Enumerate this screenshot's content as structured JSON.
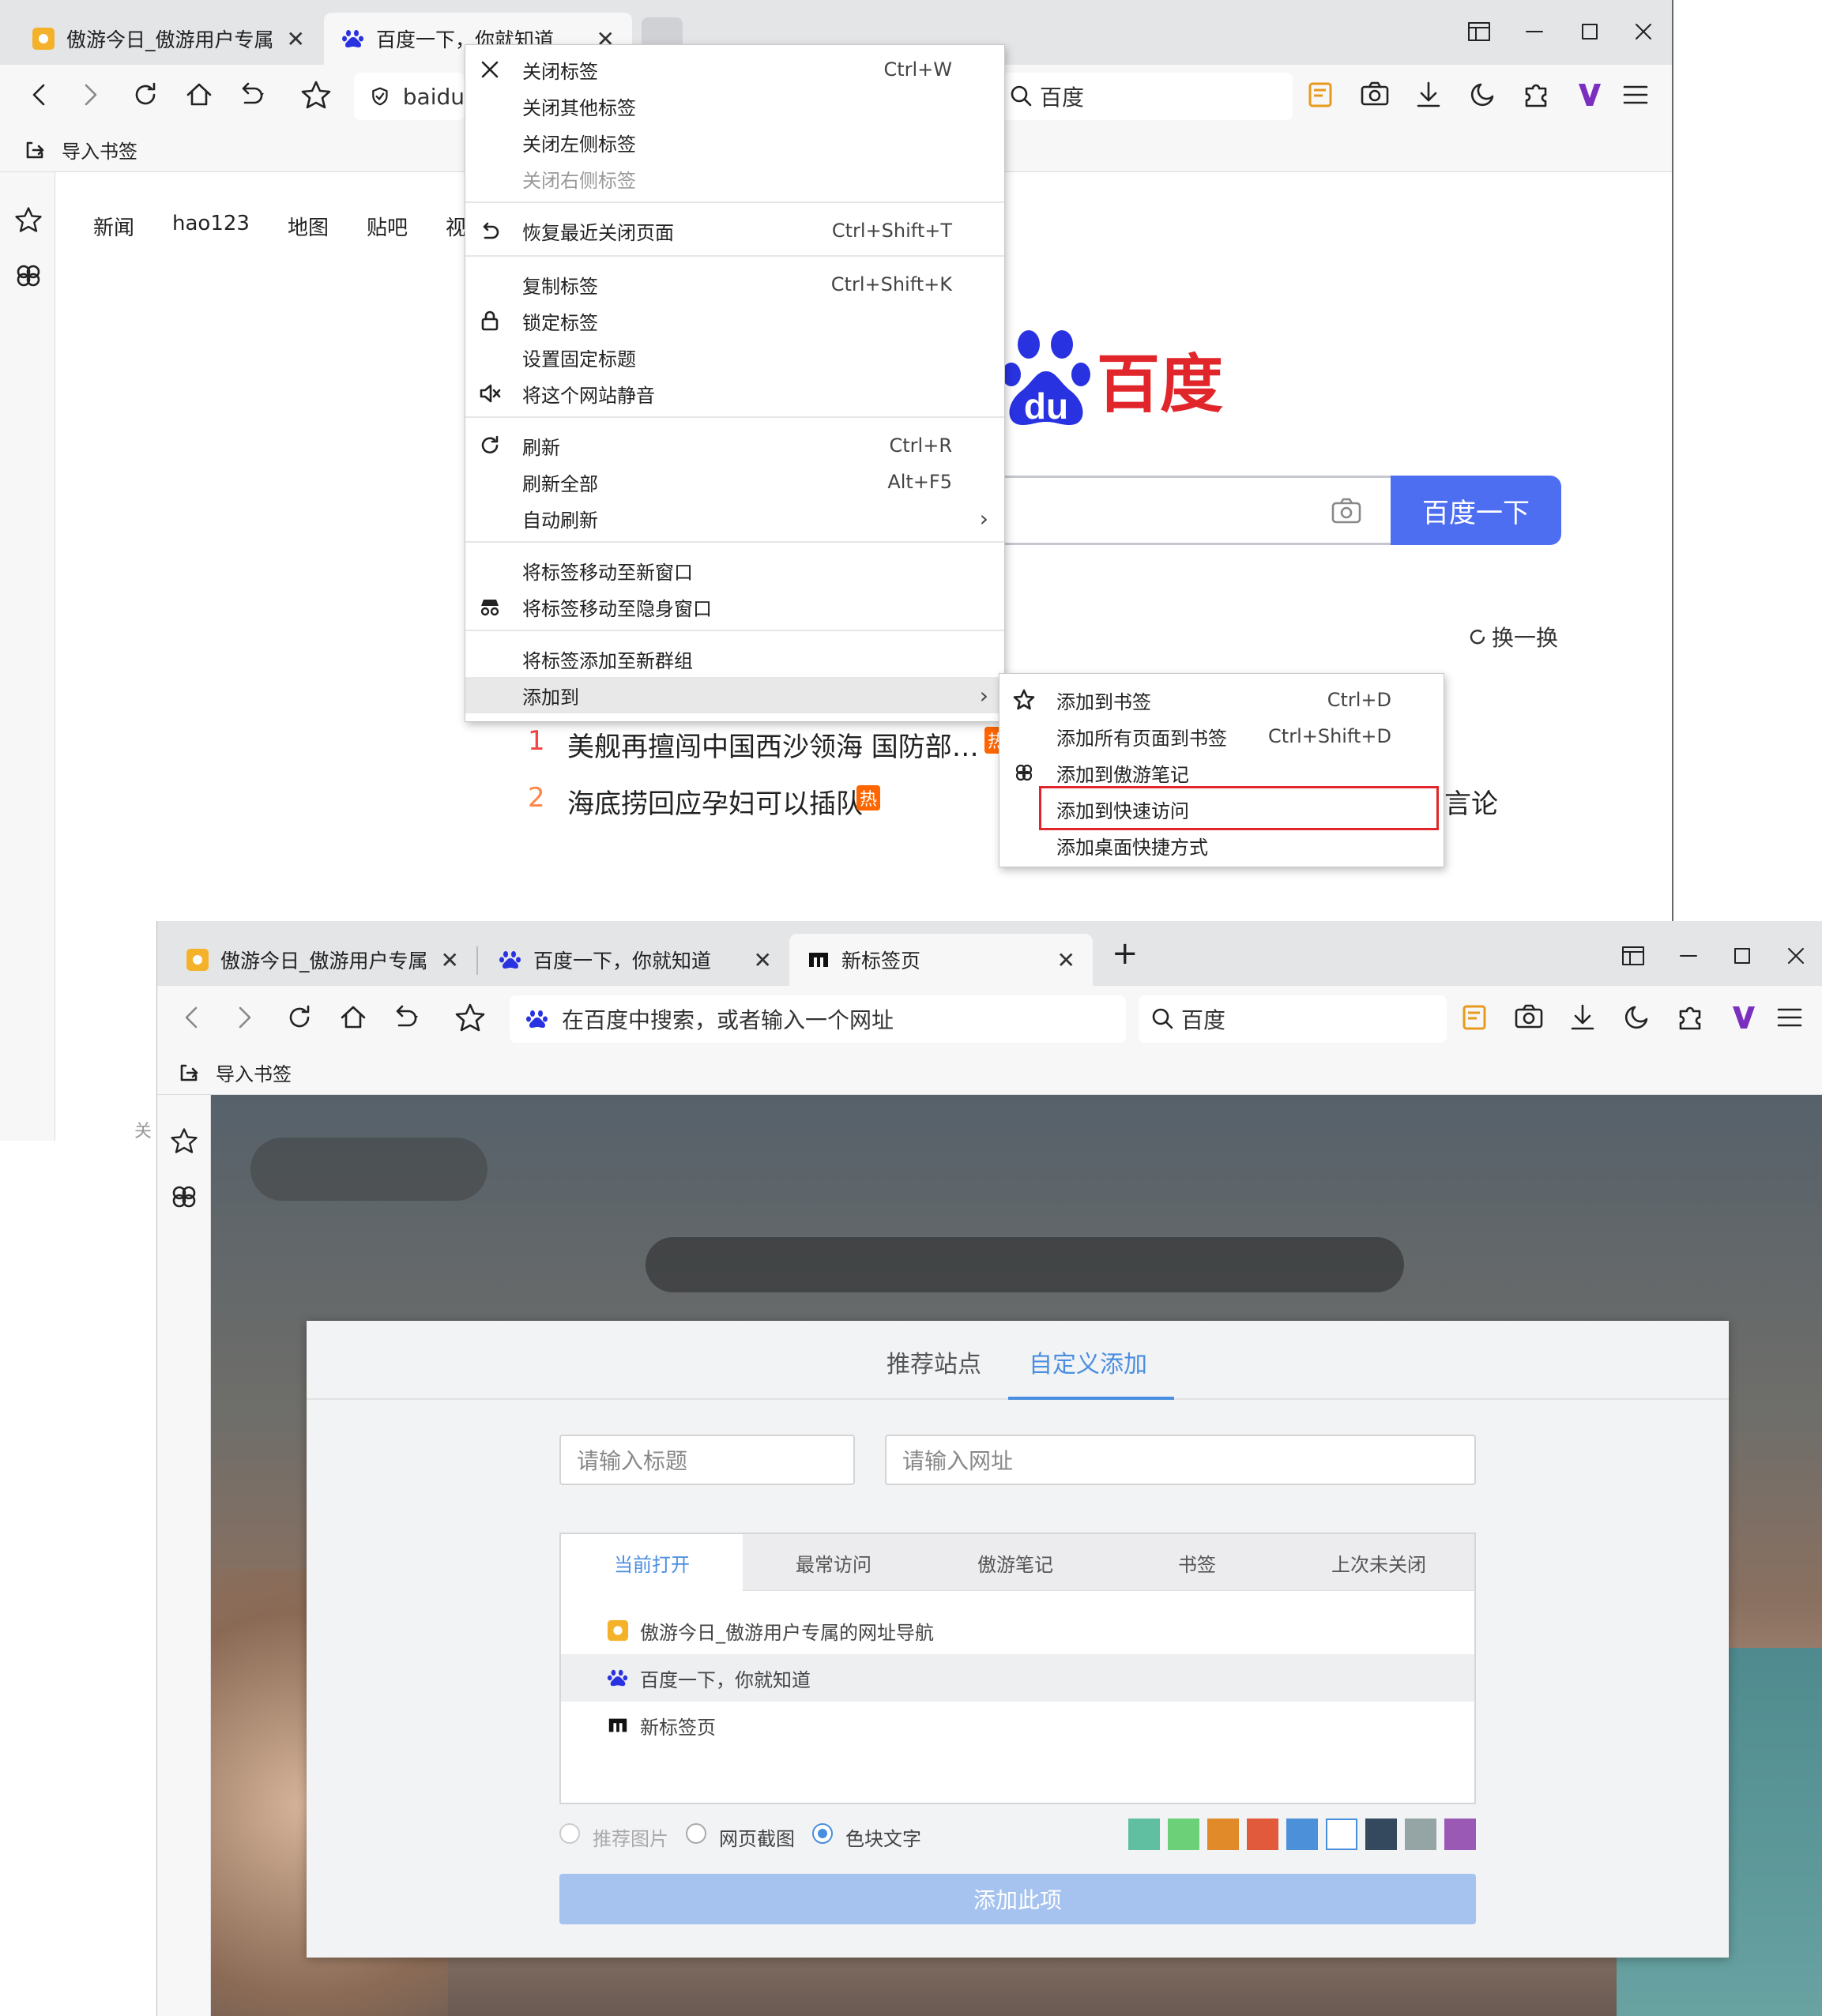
{
  "window1": {
    "tabs": [
      {
        "title": "傲游今日_傲游用户专属",
        "close": "✕"
      },
      {
        "title": "百度一下，你就知道",
        "close": "✕"
      }
    ],
    "address_text": "baidu",
    "search_engine": "百度",
    "bookmark_import": "导入书签",
    "baidu_nav": [
      "新闻",
      "hao123",
      "地图",
      "贴吧",
      "视"
    ],
    "baidu_logo_text": "百度",
    "baidu_search_button": "百度一下",
    "refresh_hot": "换一换",
    "hot_items": [
      {
        "num": "1",
        "text": "美舰再擅闯中国西沙领海 国防部…",
        "badge": "热"
      },
      {
        "num": "2",
        "text": "海底捞回应孕妇可以插队",
        "badge": "热"
      }
    ],
    "partial_text": "言论"
  },
  "context_menu": {
    "items": [
      {
        "label": "关闭标签",
        "shortcut": "Ctrl+W",
        "icon": "close-icon"
      },
      {
        "label": "关闭其他标签",
        "shortcut": ""
      },
      {
        "label": "关闭左侧标签",
        "shortcut": ""
      },
      {
        "label": "关闭右侧标签",
        "shortcut": "",
        "disabled": true
      },
      {
        "label": "恢复最近关闭页面",
        "shortcut": "Ctrl+Shift+T",
        "icon": "undo-icon"
      },
      {
        "label": "复制标签",
        "shortcut": "Ctrl+Shift+K"
      },
      {
        "label": "锁定标签",
        "shortcut": "",
        "icon": "lock-icon"
      },
      {
        "label": "设置固定标题",
        "shortcut": ""
      },
      {
        "label": "将这个网站静音",
        "shortcut": "",
        "icon": "mute-icon"
      },
      {
        "label": "刷新",
        "shortcut": "Ctrl+R",
        "icon": "refresh-icon"
      },
      {
        "label": "刷新全部",
        "shortcut": "Alt+F5"
      },
      {
        "label": "自动刷新",
        "shortcut": "›"
      },
      {
        "label": "将标签移动至新窗口",
        "shortcut": ""
      },
      {
        "label": "将标签移动至隐身窗口",
        "shortcut": "",
        "icon": "incognito-icon"
      },
      {
        "label": "将标签添加至新群组",
        "shortcut": ""
      },
      {
        "label": "添加到",
        "shortcut": "›",
        "highlighted": true
      }
    ]
  },
  "submenu": {
    "items": [
      {
        "label": "添加到书签",
        "shortcut": "Ctrl+D",
        "icon": "star-icon"
      },
      {
        "label": "添加所有页面到书签",
        "shortcut": "Ctrl+Shift+D"
      },
      {
        "label": "添加到傲游笔记",
        "shortcut": "",
        "icon": "note-icon"
      },
      {
        "label": "添加到快速访问",
        "shortcut": "",
        "boxed": true
      },
      {
        "label": "添加桌面快捷方式",
        "shortcut": ""
      }
    ],
    "highlight_color": "#e0262a"
  },
  "window2": {
    "tabs": [
      {
        "title": "傲游今日_傲游用户专属",
        "close": "✕"
      },
      {
        "title": "百度一下，你就知道",
        "close": "✕"
      },
      {
        "title": "新标签页",
        "close": "✕"
      }
    ],
    "new_tab": "+",
    "address_placeholder": "在百度中搜索，或者输入一个网址",
    "search_engine": "百度",
    "bookmark_import": "导入书签",
    "side_text": "关"
  },
  "dialog": {
    "tabs": [
      "推荐站点",
      "自定义添加"
    ],
    "active_tab": "自定义添加",
    "title_placeholder": "请输入标题",
    "url_placeholder": "请输入网址",
    "source_tabs": [
      "当前打开",
      "最常访问",
      "傲游笔记",
      "书签",
      "上次未关闭"
    ],
    "active_source": "当前打开",
    "list": [
      {
        "title": "傲游今日_傲游用户专属的网址导航",
        "icon": "maxthon-sun-icon"
      },
      {
        "title": "百度一下，你就知道",
        "icon": "baidu-paw-icon",
        "selected": true
      },
      {
        "title": "新标签页",
        "icon": "newtab-icon"
      }
    ],
    "radio_options": [
      "推荐图片",
      "网页截图",
      "色块文字"
    ],
    "radio_selected": "色块文字",
    "swatches": [
      "#5fbfa0",
      "#6cd078",
      "#e08a2a",
      "#e25a3c",
      "#4b90d8",
      "#ffffff",
      "#34495e",
      "#95a5a6",
      "#9b59b6"
    ],
    "submit": "添加此项",
    "accent": "#4a8ee0"
  }
}
